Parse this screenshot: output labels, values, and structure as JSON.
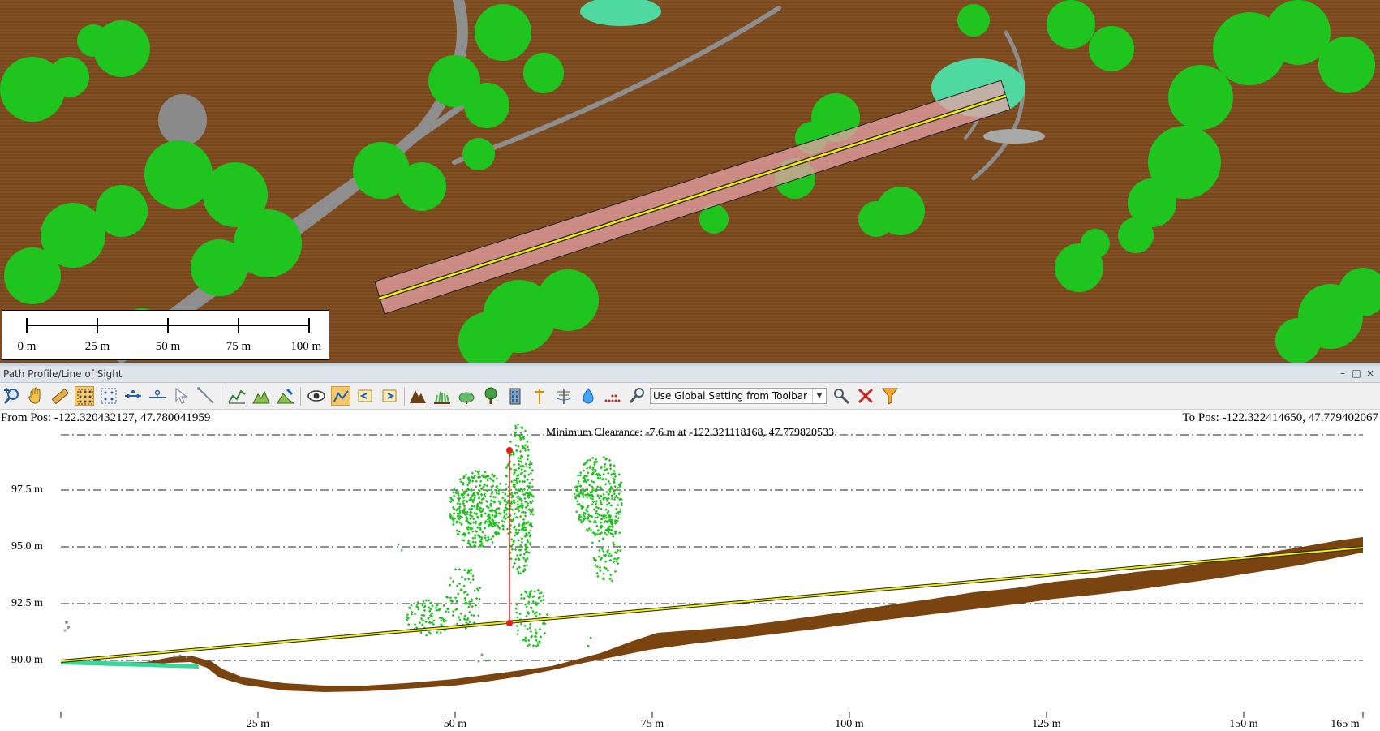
{
  "map": {
    "scale_bar": {
      "labels": [
        "0 m",
        "25 m",
        "50 m",
        "75 m",
        "100 m"
      ]
    },
    "colors": {
      "ground": "#7a4a1f",
      "vegetation": "#1fc41f",
      "road": "#8e8e8e",
      "water": "#4fd9a0",
      "path_corridor": "#e8a0a8",
      "path_line": "#f2f200"
    }
  },
  "panel": {
    "title": "Path Profile/Line of Sight",
    "window_controls": {
      "minimize": "–",
      "restore": "□",
      "close": "×"
    }
  },
  "toolbar": {
    "icons": [
      "zoom-icon",
      "pan-hand-icon",
      "measure-ruler-icon",
      "select-points-icon",
      "select-grid-icon",
      "vertex-align-icon",
      "vertex-distribute-icon",
      "pointer-icon",
      "pointer-line-icon",
      "profile-area-icon",
      "terrain-chart-icon",
      "terrain-edit-icon",
      "line-of-sight-eye-icon",
      "chart-line-icon",
      "arrow-left-icon",
      "arrow-right-icon",
      "mountain-icon",
      "grass-icon",
      "shrub-icon",
      "tree-icon",
      "building-icon",
      "tower-icon",
      "power-line-icon",
      "water-icon",
      "points-dots-icon",
      "settings-tool-icon"
    ],
    "settings_select": {
      "value": "Use Global Setting from Toolbar"
    },
    "right_icons": [
      "tools-icon",
      "clear-icon",
      "filter-icon"
    ]
  },
  "profile": {
    "from_pos": "From Pos: -122.320432127, 47.780041959",
    "to_pos": "To Pos: -122.322414650, 47.779402067",
    "min_clearance": "Minimum Clearance: -7.6 m at -122.321118168, 47.779820533",
    "y_tick_labels": [
      "97.5 m",
      "95.0 m",
      "92.5 m",
      "90.0 m"
    ],
    "x_tick_labels": [
      "25 m",
      "50 m",
      "75 m",
      "100 m",
      "125 m",
      "150 m",
      "165 m"
    ],
    "line_of_sight": {
      "start_elev_m": 90.0,
      "end_elev_m": 95.0,
      "length_m": 165
    },
    "clearance_marker": {
      "distance_m": 57,
      "top_elev_m": 99.2,
      "bottom_elev_m": 91.6
    }
  }
}
